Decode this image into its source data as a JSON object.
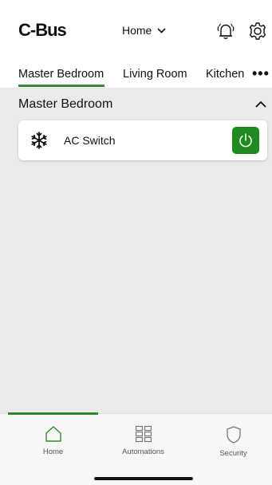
{
  "colors": {
    "accent": "#2f8a2f",
    "power_on": "#1f8a1f",
    "background": "#ebebeb",
    "surface": "#ffffff"
  },
  "header": {
    "logo": "C-Bus",
    "home_selector": "Home",
    "icons": [
      "bell-icon",
      "gear-icon",
      "chevron-down-icon"
    ]
  },
  "tabs": [
    {
      "label": "Master Bedroom",
      "active": true
    },
    {
      "label": "Living Room",
      "active": false
    },
    {
      "label": "Kitchen",
      "active": false
    }
  ],
  "tabs_more": "•••",
  "section": {
    "title": "Master Bedroom",
    "expanded": true
  },
  "devices": [
    {
      "name": "AC Switch",
      "icon": "snowflake-icon",
      "power_on": true
    }
  ],
  "bottom_nav": {
    "items": [
      {
        "label": "Home",
        "icon": "home-icon",
        "active": true
      },
      {
        "label": "Automations",
        "icon": "grid-icon",
        "active": false
      },
      {
        "label": "Security",
        "icon": "shield-icon",
        "active": false
      }
    ]
  }
}
